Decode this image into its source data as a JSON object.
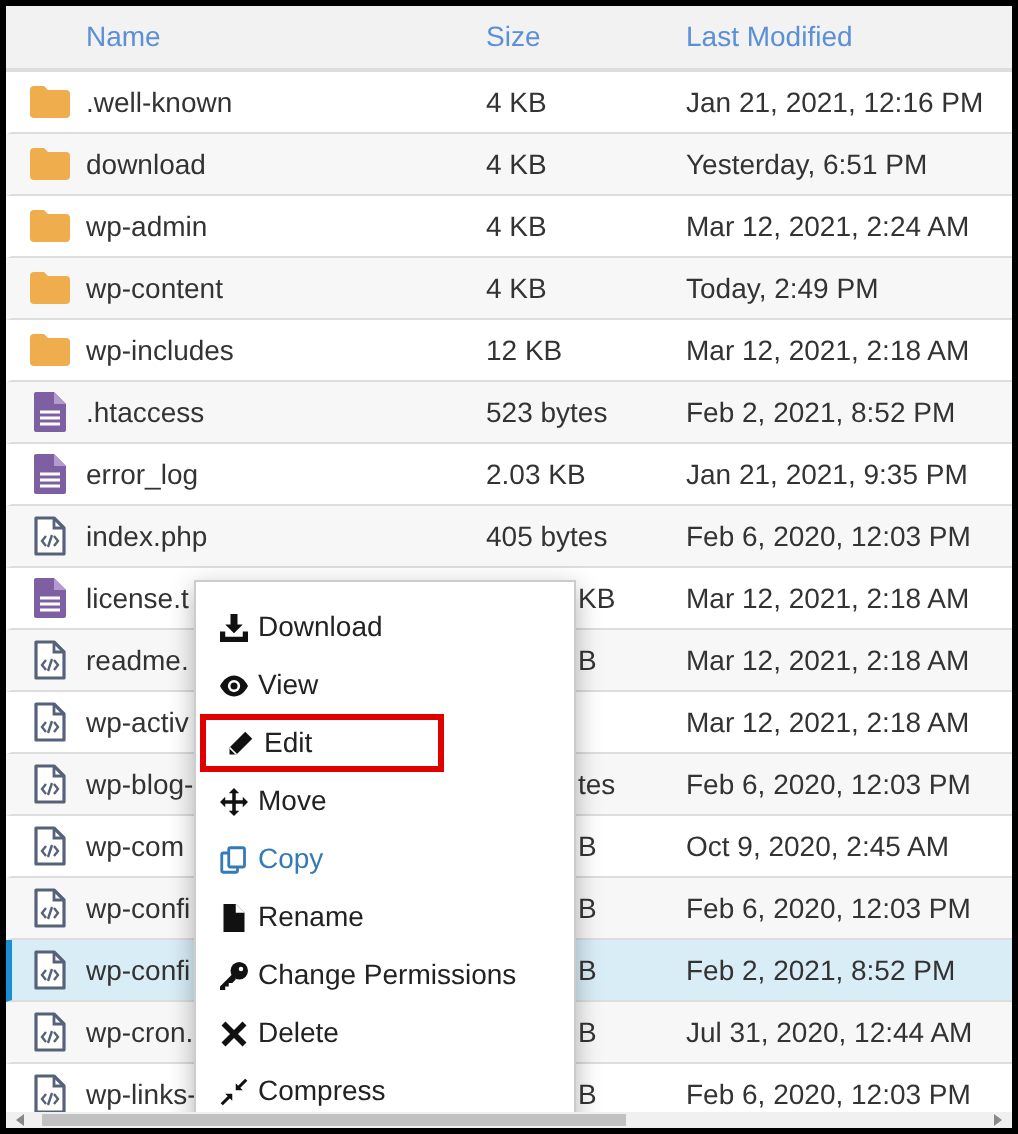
{
  "table": {
    "columns": [
      "Name",
      "Size",
      "Last Modified"
    ],
    "rows": [
      {
        "kind": "folder",
        "name": ".well-known",
        "size": "4 KB",
        "modified": "Jan 21, 2021, 12:16 PM",
        "selected": false
      },
      {
        "kind": "folder",
        "name": "download",
        "size": "4 KB",
        "modified": "Yesterday, 6:51 PM",
        "selected": false
      },
      {
        "kind": "folder",
        "name": "wp-admin",
        "size": "4 KB",
        "modified": "Mar 12, 2021, 2:24 AM",
        "selected": false
      },
      {
        "kind": "folder",
        "name": "wp-content",
        "size": "4 KB",
        "modified": "Today, 2:49 PM",
        "selected": false
      },
      {
        "kind": "folder",
        "name": "wp-includes",
        "size": "12 KB",
        "modified": "Mar 12, 2021, 2:18 AM",
        "selected": false
      },
      {
        "kind": "text",
        "name": ".htaccess",
        "size": "523 bytes",
        "modified": "Feb 2, 2021, 8:52 PM",
        "selected": false
      },
      {
        "kind": "text",
        "name": "error_log",
        "size": "2.03 KB",
        "modified": "Jan 21, 2021, 9:35 PM",
        "selected": false
      },
      {
        "kind": "code",
        "name": "index.php",
        "size": "405 bytes",
        "modified": "Feb 6, 2020, 12:03 PM",
        "selected": false
      },
      {
        "kind": "text",
        "name": "license.t",
        "size": "KB",
        "modified": "Mar 12, 2021, 2:18 AM",
        "selected": false,
        "under_menu": true
      },
      {
        "kind": "code",
        "name": "readme.",
        "size": "B",
        "modified": "Mar 12, 2021, 2:18 AM",
        "selected": false,
        "under_menu": true
      },
      {
        "kind": "code",
        "name": "wp-activ",
        "modified": "Mar 12, 2021, 2:18 AM",
        "selected": false
      },
      {
        "kind": "code",
        "name": "wp-blog-",
        "size": "tes",
        "modified": "Feb 6, 2020, 12:03 PM",
        "selected": false,
        "under_menu": true
      },
      {
        "kind": "code",
        "name": "wp-com",
        "size": "B",
        "modified": "Oct 9, 2020, 2:45 AM",
        "selected": false,
        "under_menu": true
      },
      {
        "kind": "code",
        "name": "wp-confi",
        "size": "B",
        "modified": "Feb 6, 2020, 12:03 PM",
        "selected": false,
        "under_menu": true
      },
      {
        "kind": "code",
        "name": "wp-confi",
        "size": "B",
        "modified": "Feb 2, 2021, 8:52 PM",
        "selected": true,
        "under_menu": true
      },
      {
        "kind": "code",
        "name": "wp-cron.",
        "size": "B",
        "modified": "Jul 31, 2020, 12:44 AM",
        "selected": false,
        "under_menu": true
      },
      {
        "kind": "code",
        "name": "wp-links-",
        "size": "B",
        "modified": "Feb 6, 2020, 12:03 PM",
        "selected": false,
        "under_menu": true
      }
    ]
  },
  "context_menu": {
    "items": [
      {
        "kind": "download",
        "label": "Download",
        "highlighted": false,
        "outlined": false
      },
      {
        "kind": "view",
        "label": "View",
        "highlighted": false,
        "outlined": false
      },
      {
        "kind": "edit",
        "label": "Edit",
        "highlighted": false,
        "outlined": true
      },
      {
        "kind": "move",
        "label": "Move",
        "highlighted": false,
        "outlined": false
      },
      {
        "kind": "copy",
        "label": "Copy",
        "highlighted": true,
        "outlined": false
      },
      {
        "kind": "rename",
        "label": "Rename",
        "highlighted": false,
        "outlined": false
      },
      {
        "kind": "permissions",
        "label": "Change Permissions",
        "highlighted": false,
        "outlined": false
      },
      {
        "kind": "delete",
        "label": "Delete",
        "highlighted": false,
        "outlined": false
      },
      {
        "kind": "compress",
        "label": "Compress",
        "highlighted": false,
        "outlined": false
      }
    ]
  }
}
